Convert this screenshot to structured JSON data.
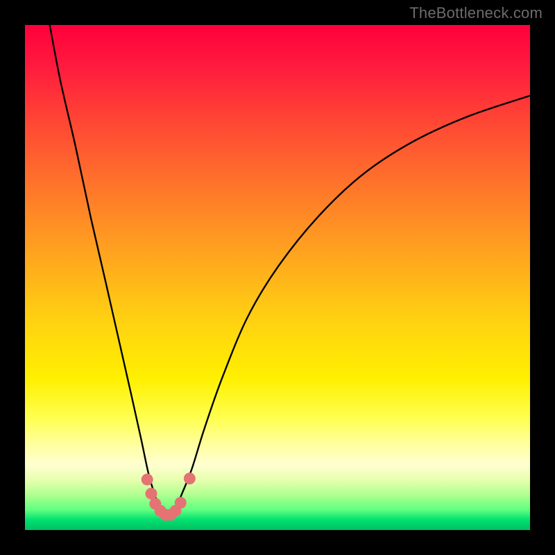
{
  "watermark": "TheBottleneck.com",
  "colors": {
    "frame": "#000000",
    "curve": "#000000",
    "marker_fill": "#e57373",
    "marker_stroke": "#c05050"
  },
  "chart_data": {
    "type": "line",
    "title": "",
    "xlabel": "",
    "ylabel": "",
    "xlim": [
      0,
      100
    ],
    "ylim": [
      0,
      100
    ],
    "note": "Axis values are relative (0-100) because no tick labels are shown in the image; curve and marker coordinates estimated from pixels.",
    "series": [
      {
        "name": "bottleneck-curve",
        "x": [
          4.9,
          7.0,
          10.0,
          13.0,
          16.0,
          18.5,
          21.0,
          23.0,
          24.5,
          26.0,
          27.0,
          28.2,
          29.5,
          31.0,
          33.0,
          35.5,
          39.0,
          44.0,
          50.0,
          58.0,
          67.0,
          77.0,
          88.0,
          100.0
        ],
        "y": [
          100.0,
          89.0,
          76.0,
          62.0,
          49.0,
          38.0,
          27.0,
          18.0,
          11.0,
          6.0,
          3.0,
          2.2,
          3.5,
          7.0,
          12.0,
          20.0,
          30.0,
          42.0,
          52.0,
          62.0,
          70.5,
          77.0,
          82.0,
          86.0
        ]
      }
    ],
    "markers": [
      {
        "x": 24.2,
        "y": 10.0
      },
      {
        "x": 25.0,
        "y": 7.2
      },
      {
        "x": 25.8,
        "y": 5.2
      },
      {
        "x": 26.8,
        "y": 3.8
      },
      {
        "x": 27.8,
        "y": 3.0
      },
      {
        "x": 28.8,
        "y": 3.0
      },
      {
        "x": 29.8,
        "y": 3.8
      },
      {
        "x": 30.8,
        "y": 5.4
      },
      {
        "x": 32.6,
        "y": 10.2
      }
    ]
  }
}
